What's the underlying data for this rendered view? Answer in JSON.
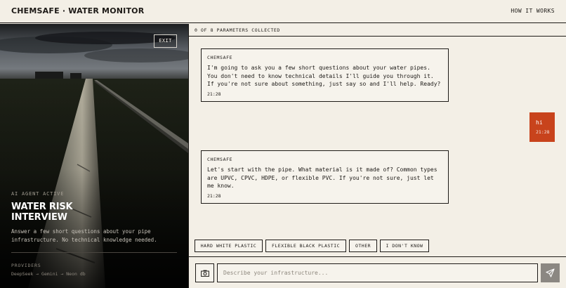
{
  "header": {
    "brand": "CHEMSAFE · WATER MONITOR",
    "nav_link": "HOW IT WORKS"
  },
  "left_panel": {
    "exit_label": "EXIT",
    "status": "AI AGENT ACTIVE",
    "title": "WATER RISK INTERVIEW",
    "description": "Answer a few short questions about your pipe infrastructure. No technical knowledge needed.",
    "providers_label": "PROVIDERS",
    "providers_chain": "DeepSeek → Gemini → Neon db"
  },
  "chat": {
    "progress": "0 OF 8 PARAMETERS COLLECTED",
    "messages": [
      {
        "sender": "CHEMSAFE",
        "text": "I'm going to ask you a few short questions about your water pipes. You don't need to know technical details  I'll guide you through it. If you're not sure about something, just say so and I'll help. Ready?",
        "time": "21:28"
      },
      {
        "sender": "",
        "text": "hi",
        "time": "21:28"
      },
      {
        "sender": "CHEMSAFE",
        "text": "Let's start with the pipe. What material is it made of? Common types are UPVC, CPVC, HDPE, or flexible PVC. If you're not sure, just let me know.",
        "time": "21:28"
      }
    ],
    "quick_replies": [
      "HARD WHITE PLASTIC",
      "FLEXIBLE BLACK PLASTIC",
      "OTHER",
      "I DON'T KNOW"
    ],
    "input": {
      "value": "",
      "placeholder": "Describe your infrastructure..."
    }
  },
  "icons": {
    "camera": "camera-icon",
    "send": "send-icon"
  },
  "colors": {
    "background": "#f3efe6",
    "ink": "#1d1a17",
    "accent": "#c8431c",
    "send_button": "#8b8782"
  }
}
